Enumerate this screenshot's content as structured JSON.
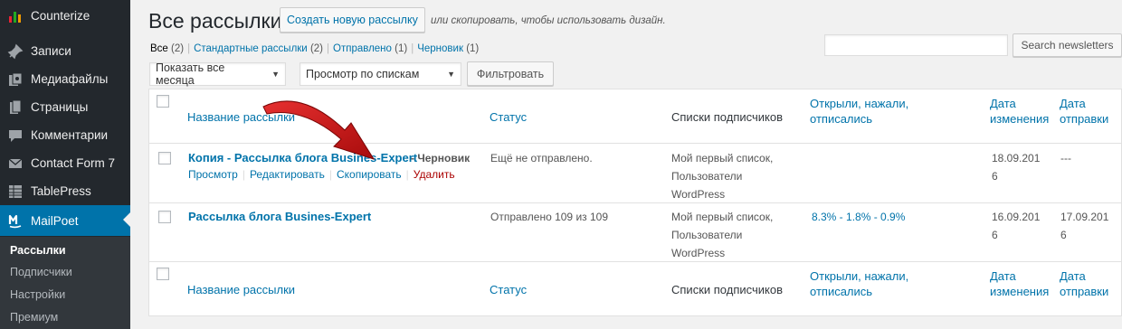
{
  "sidebar": {
    "items": [
      {
        "label": "Counterize",
        "icon": "chart-icon"
      },
      {
        "label": "Записи",
        "icon": "pin-icon"
      },
      {
        "label": "Медиафайлы",
        "icon": "media-icon"
      },
      {
        "label": "Страницы",
        "icon": "page-icon"
      },
      {
        "label": "Комментарии",
        "icon": "comment-icon"
      },
      {
        "label": "Contact Form 7",
        "icon": "mail-icon"
      },
      {
        "label": "TablePress",
        "icon": "table-icon"
      },
      {
        "label": "MailPoet",
        "icon": "mailpoet-icon"
      }
    ],
    "submenu": [
      "Рассылки",
      "Подписчики",
      "Настройки",
      "Премиум"
    ]
  },
  "header": {
    "title": "Все рассылки",
    "create_button": "Создать новую рассылку",
    "hint": "или скопировать, чтобы использовать дизайн."
  },
  "views": [
    {
      "label": "Все",
      "count": "(2)"
    },
    {
      "label": "Стандартные рассылки",
      "count": "(2)"
    },
    {
      "label": "Отправлено",
      "count": "(1)"
    },
    {
      "label": "Черновик",
      "count": "(1)"
    }
  ],
  "search": {
    "placeholder": "",
    "button": "Search newsletters"
  },
  "filters": {
    "month": "Показать все месяца",
    "lists": "Просмотр по спискам",
    "button": "Фильтровать"
  },
  "table": {
    "columns": {
      "name": "Название рассылки",
      "status": "Статус",
      "lists": "Списки подписчиков",
      "stats_1": "Открыли, нажали,",
      "stats_2": "отписались",
      "modified_1": "Дата",
      "modified_2": "изменения",
      "sent_1": "Дата",
      "sent_2": "отправки"
    },
    "rows": [
      {
        "title": "Копия - Рассылка блога Busines-Expert",
        "state": "- Черновик",
        "actions": [
          "Просмотр",
          "Редактировать",
          "Скопировать",
          "Удалить"
        ],
        "status": "Ещё не отправлено.",
        "lists": [
          "Мой первый список,",
          "Пользователи",
          "WordPress"
        ],
        "stats": "",
        "modified": [
          "18.09.201",
          "6"
        ],
        "sent": "---"
      },
      {
        "title": "Рассылка блога Busines-Expert",
        "state": "",
        "actions": [],
        "status": "Отправлено 109 из 109",
        "lists": [
          "Мой первый список,",
          "Пользователи",
          "WordPress"
        ],
        "stats": "8.3% - 1.8% - 0.9%",
        "modified": [
          "16.09.201",
          "6"
        ],
        "sent": [
          "17.09.201",
          "6"
        ]
      }
    ]
  },
  "colors": {
    "sidebar": "#23282d",
    "active": "#0073aa",
    "link": "#0073aa",
    "delete": "#aa0000",
    "arrow": "#cc1111"
  }
}
